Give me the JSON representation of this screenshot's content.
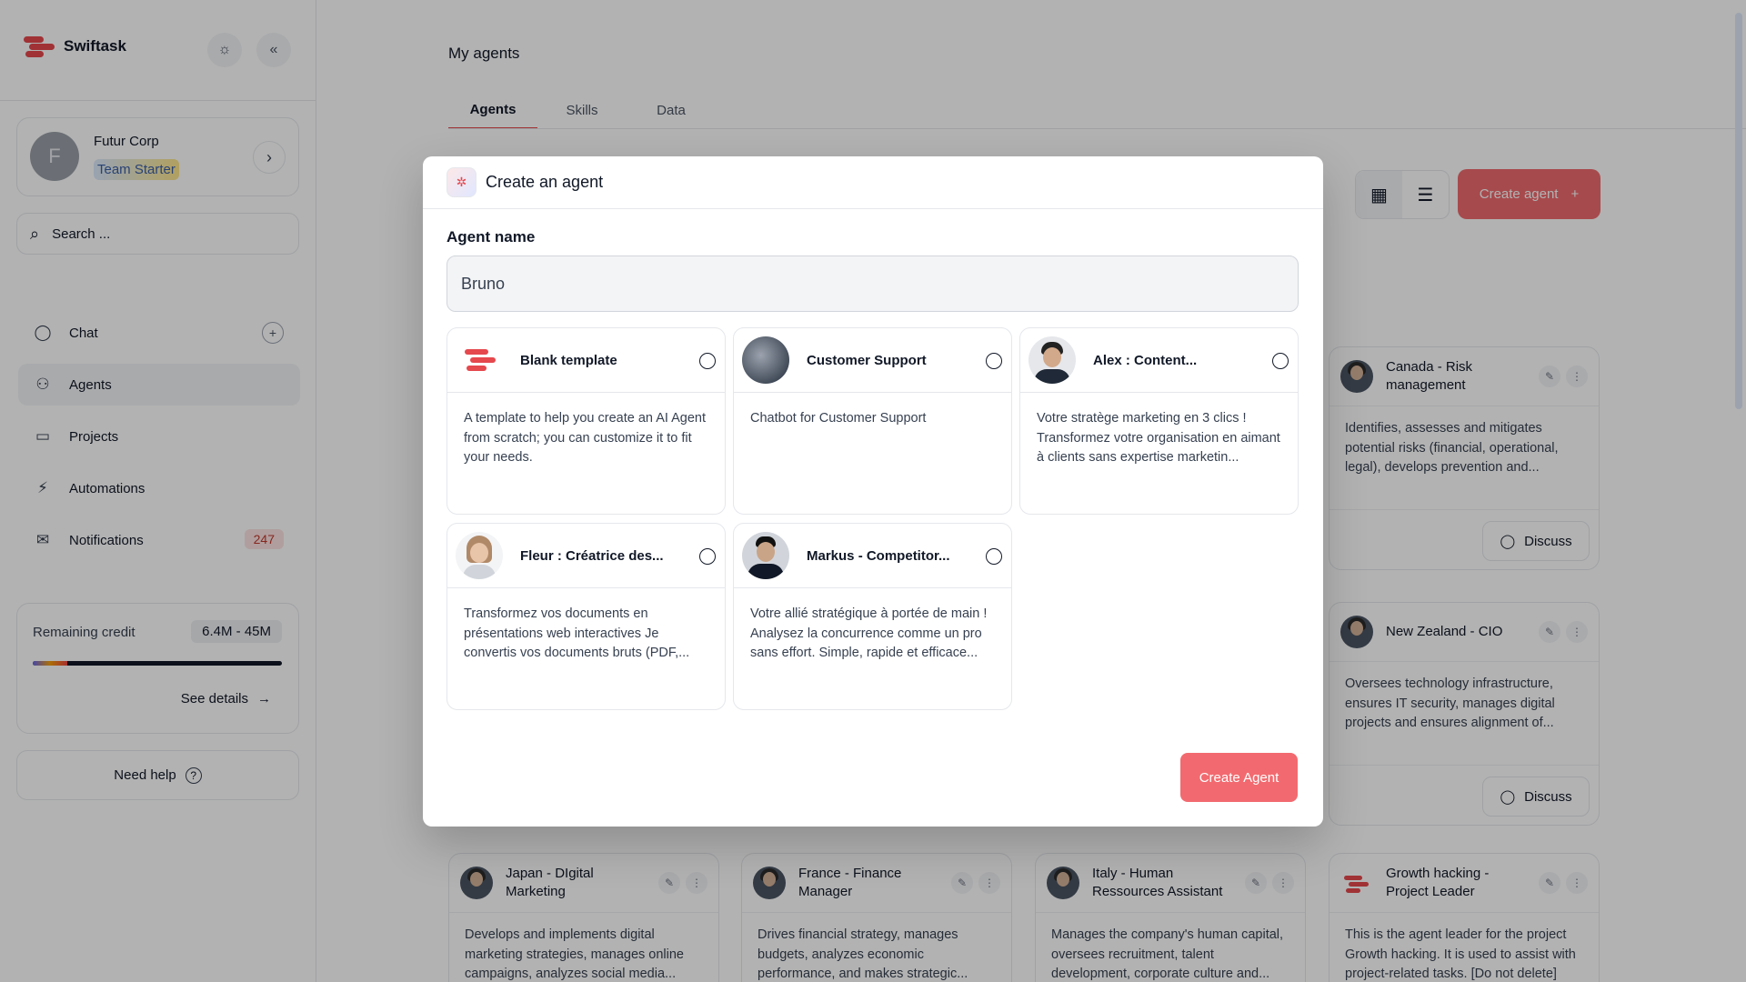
{
  "app": {
    "name": "Swiftask"
  },
  "org": {
    "avatar_letter": "F",
    "name": "Futur Corp",
    "plan": "Team Starter"
  },
  "search": {
    "placeholder": "Search ..."
  },
  "nav": {
    "chat": "Chat",
    "agents": "Agents",
    "projects": "Projects",
    "automations": "Automations",
    "notifications": "Notifications",
    "notifications_count": "247"
  },
  "credit": {
    "label": "Remaining credit",
    "value": "6.4M - 45M",
    "used_fraction": 0.14,
    "details_link": "See details"
  },
  "help": {
    "label": "Need help"
  },
  "page": {
    "title": "My agents",
    "tabs": [
      "Agents",
      "Skills",
      "Data"
    ],
    "create_agent_label": "Create agent"
  },
  "agent_cards": [
    {
      "title": "Canada - Risk management",
      "desc": "Identifies, assesses and mitigates potential risks (financial, operational, legal), develops prevention and...",
      "action": "Discuss"
    },
    {
      "title": "New Zealand - CIO",
      "desc": "Oversees technology infrastructure, ensures IT security, manages digital projects and ensures alignment of...",
      "action": "Discuss"
    },
    {
      "title": "Japan - DIgital Marketing",
      "desc": "Develops and implements digital marketing strategies, manages online campaigns, analyzes social media..."
    },
    {
      "title": "France - Finance Manager",
      "desc": "Drives financial strategy, manages budgets, analyzes economic performance, and makes strategic..."
    },
    {
      "title": "Italy - Human Ressources Assistant",
      "desc": "Manages the company's human capital, oversees recruitment, talent development, corporate culture and..."
    },
    {
      "title": "Growth hacking - Project Leader",
      "desc": "This is the agent leader for the project Growth hacking. It is used to assist with project-related tasks. [Do not delete]"
    }
  ],
  "modal": {
    "title": "Create an agent",
    "field_label": "Agent name",
    "agent_name_value": "Bruno",
    "templates": [
      {
        "name": "Blank template",
        "desc": "A template to help you create an AI Agent from scratch; you can customize it to fit your needs."
      },
      {
        "name": "Customer Support",
        "desc": "Chatbot for Customer Support"
      },
      {
        "name": "Alex : Content...",
        "desc": "Votre stratège marketing en 3 clics ! Transformez votre organisation en aimant à clients sans expertise marketin..."
      },
      {
        "name": "Fleur : Créatrice des...",
        "desc": "Transformez vos documents en présentations web interactives Je convertis vos documents bruts (PDF,..."
      },
      {
        "name": "Markus - Competitor...",
        "desc": "Votre allié stratégique à portée de main ! Analysez la concurrence comme un pro sans effort. Simple, rapide et efficace..."
      }
    ],
    "submit_label": "Create Agent"
  },
  "colors": {
    "accent": "#e5484d",
    "button": "#f26a6f",
    "overlay": "rgba(0,0,0,0.3)"
  },
  "icons": {
    "theme": "sun-icon",
    "collapse": "double-chevron-left-icon",
    "search": "search-icon",
    "chat": "chat-bubble-icon",
    "agents": "robot-icon",
    "projects": "folder-icon",
    "automations": "automation-icon",
    "notifications": "mail-icon"
  }
}
